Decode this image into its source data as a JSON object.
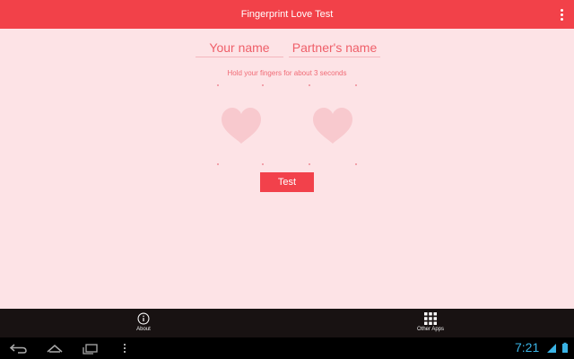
{
  "app": {
    "title": "Fingerprint Love Test"
  },
  "form": {
    "name1_placeholder": "Your name",
    "name1_value": "",
    "name2_placeholder": "Partner's name",
    "name2_value": "",
    "instruction": "Hold your fingers for about 3 seconds",
    "test_label": "Test"
  },
  "action_bar": {
    "items": [
      {
        "label": "About",
        "icon": "info-circle-icon"
      },
      {
        "label": "Other Apps",
        "icon": "grid-apps-icon"
      }
    ]
  },
  "system_bar": {
    "time": "7:21",
    "nav": [
      "back-icon",
      "home-icon",
      "recent-apps-icon",
      "menu-icon"
    ]
  },
  "colors": {
    "accent": "#f24149",
    "background": "#fde3e6",
    "heart": "#f8c9ce",
    "action_bar": "#181212",
    "clock": "#3ab4e6"
  }
}
